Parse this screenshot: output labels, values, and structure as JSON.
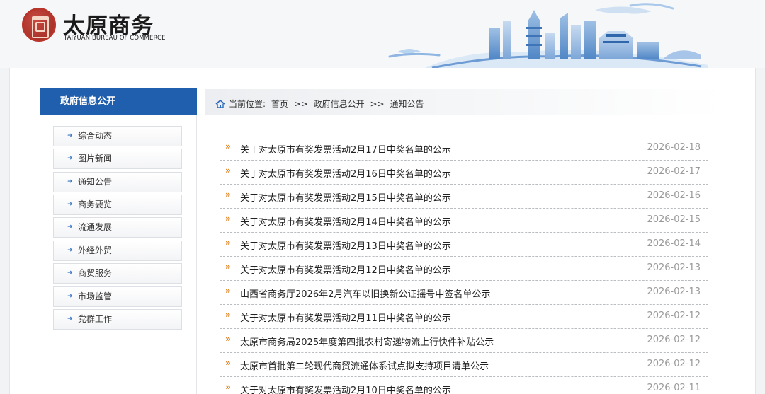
{
  "header": {
    "logo_cn": "太原商务",
    "logo_en": "TAIYUAN BUREAU OF COMMERCE"
  },
  "sidebar": {
    "title": "政府信息公开",
    "items": [
      {
        "label": "综合动态"
      },
      {
        "label": "图片新闻"
      },
      {
        "label": "通知公告"
      },
      {
        "label": "商务要览"
      },
      {
        "label": "流通发展"
      },
      {
        "label": "外经外贸"
      },
      {
        "label": "商贸服务"
      },
      {
        "label": "市场监管"
      },
      {
        "label": "党群工作"
      }
    ]
  },
  "breadcrumb": {
    "prefix": "当前位置:",
    "home": "首页",
    "sep1": ">>",
    "section": "政府信息公开",
    "sep2": ">>",
    "current": "通知公告"
  },
  "news": {
    "bullet": "»",
    "items": [
      {
        "title": "关于对太原市有奖发票活动2月17日中奖名单的公示",
        "date": "2026-02-18"
      },
      {
        "title": "关于对太原市有奖发票活动2月16日中奖名单的公示",
        "date": "2026-02-17"
      },
      {
        "title": "关于对太原市有奖发票活动2月15日中奖名单的公示",
        "date": "2026-02-16"
      },
      {
        "title": "关于对太原市有奖发票活动2月14日中奖名单的公示",
        "date": "2026-02-15"
      },
      {
        "title": "关于对太原市有奖发票活动2月13日中奖名单的公示",
        "date": "2026-02-14"
      },
      {
        "title": "关于对太原市有奖发票活动2月12日中奖名单的公示",
        "date": "2026-02-13"
      },
      {
        "title": "山西省商务厅2026年2月汽车以旧换新公证摇号中签名单公示",
        "date": "2026-02-13"
      },
      {
        "title": "关于对太原市有奖发票活动2月11日中奖名单的公示",
        "date": "2026-02-12"
      },
      {
        "title": "太原市商务局2025年度第四批农村寄递物流上行快件补贴公示",
        "date": "2026-02-12"
      },
      {
        "title": "太原市首批第二轮现代商贸流通体系试点拟支持项目清单公示",
        "date": "2026-02-12"
      },
      {
        "title": "关于对太原市有奖发票活动2月10日中奖名单的公示",
        "date": "2026-02-11"
      }
    ]
  },
  "colors": {
    "sidebar_header": "#1f5fae",
    "bullet": "#e07a16",
    "date": "#9a9a9a",
    "seal": "#b8352c"
  },
  "icons": [
    "seal-logo",
    "skyline-banner",
    "home-icon",
    "arrow-icon",
    "double-chevron-icon"
  ]
}
